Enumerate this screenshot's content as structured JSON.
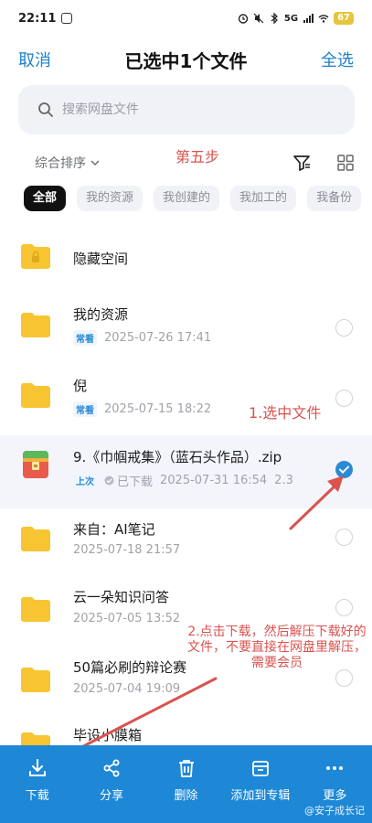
{
  "status_bar": {
    "time": "22:11",
    "network": "5G",
    "battery": "67"
  },
  "header": {
    "cancel_label": "取消",
    "title": "已选中1个文件",
    "select_all_label": "全选"
  },
  "search": {
    "placeholder": "搜索网盘文件"
  },
  "sort": {
    "label": "综合排序"
  },
  "annotations": {
    "step": "第五步",
    "select_file": "1.选中文件",
    "download_tip": "2.点击下载，然后解压下载好的文件，不要直接在网盘里解压，需要会员"
  },
  "chips": [
    "全部",
    "我的资源",
    "我创建的",
    "我加工的",
    "我备份"
  ],
  "files": [
    {
      "name": "隐藏空间",
      "tag": "",
      "date": "",
      "checked": false,
      "type": "locked-folder"
    },
    {
      "name": "我的资源",
      "tag": "常看",
      "date": "2025-07-26  17:41",
      "checked": false,
      "type": "folder"
    },
    {
      "name": "倪",
      "tag": "常看",
      "date": "2025-07-15  18:22",
      "checked": false,
      "type": "folder"
    },
    {
      "name": "9.《巾帼戒集》（蓝石头作品）.zip",
      "tag": "上次",
      "downloaded": "已下载",
      "date": "2025-07-31  16:54",
      "size": "2.3",
      "checked": true,
      "type": "zip"
    },
    {
      "name": "来自：AI笔记",
      "tag": "",
      "date": "2025-07-18  21:57",
      "checked": false,
      "type": "folder"
    },
    {
      "name": "云一朵知识问答",
      "tag": "",
      "date": "2025-07-05  13:52",
      "checked": false,
      "type": "folder"
    },
    {
      "name": "50篇必刷的辩论赛",
      "tag": "",
      "date": "2025-07-04  19:09",
      "checked": false,
      "type": "folder"
    },
    {
      "name": "毕设小膜箱",
      "tag": "",
      "date": "",
      "checked": false,
      "type": "folder"
    }
  ],
  "toolbar": {
    "download": "下载",
    "share": "分享",
    "delete": "删除",
    "add_to_album": "添加到专辑",
    "more": "更多"
  },
  "watermark": "@安子成长记",
  "colors": {
    "accent": "#1e88d7",
    "annotation": "#d9534f",
    "folder": "#f7c531"
  }
}
